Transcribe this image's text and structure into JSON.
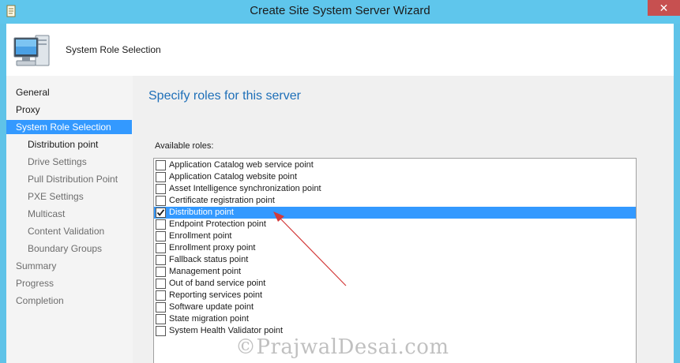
{
  "window": {
    "title": "Create Site System Server Wizard",
    "close_symbol": "✕",
    "app_icon": "wizard-scroll-icon"
  },
  "header": {
    "title": "System Role Selection",
    "icon": "computer-monitor-icon"
  },
  "nav": {
    "items": [
      {
        "label": "General",
        "level": 0
      },
      {
        "label": "Proxy",
        "level": 0
      },
      {
        "label": "System Role Selection",
        "level": 0,
        "active": true
      },
      {
        "label": "Distribution point",
        "level": 1
      },
      {
        "label": "Drive Settings",
        "level": 1
      },
      {
        "label": "Pull Distribution Point",
        "level": 1
      },
      {
        "label": "PXE Settings",
        "level": 1
      },
      {
        "label": "Multicast",
        "level": 1
      },
      {
        "label": "Content Validation",
        "level": 1
      },
      {
        "label": "Boundary Groups",
        "level": 1
      },
      {
        "label": "Summary",
        "level": 0
      },
      {
        "label": "Progress",
        "level": 0
      },
      {
        "label": "Completion",
        "level": 0
      }
    ]
  },
  "main": {
    "heading": "Specify roles for this server",
    "available_label": "Available roles:",
    "roles": [
      {
        "label": "Application Catalog web service point",
        "checked": false
      },
      {
        "label": "Application Catalog website point",
        "checked": false
      },
      {
        "label": "Asset Intelligence synchronization point",
        "checked": false
      },
      {
        "label": "Certificate registration point",
        "checked": false
      },
      {
        "label": "Distribution point",
        "checked": true,
        "selected": true
      },
      {
        "label": "Endpoint Protection point",
        "checked": false
      },
      {
        "label": "Enrollment point",
        "checked": false
      },
      {
        "label": "Enrollment proxy point",
        "checked": false
      },
      {
        "label": "Fallback status point",
        "checked": false
      },
      {
        "label": "Management point",
        "checked": false
      },
      {
        "label": "Out of band service point",
        "checked": false
      },
      {
        "label": "Reporting services point",
        "checked": false
      },
      {
        "label": "Software update point",
        "checked": false
      },
      {
        "label": "State migration point",
        "checked": false
      },
      {
        "label": "System Health Validator point",
        "checked": false
      }
    ]
  },
  "watermark": "©PrajwalDesai.com",
  "colors": {
    "titlebar": "#5fc6ec",
    "selection": "#3399ff",
    "heading": "#1e6fb8",
    "close": "#c75050",
    "arrow": "#d33a3a"
  }
}
